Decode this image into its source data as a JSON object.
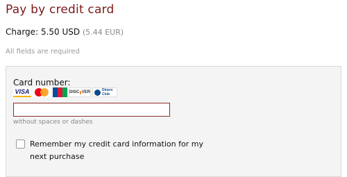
{
  "page_title": "Pay by credit card",
  "charge": {
    "label": "Charge:",
    "amount": "5.50 USD",
    "converted": "(5.44 EUR)"
  },
  "required_note": "All fields are required",
  "card_number": {
    "label": "Card number:",
    "value": "",
    "hint": "without spaces or dashes"
  },
  "card_logos": [
    {
      "icon": "visa-logo",
      "text": "VISA"
    },
    {
      "icon": "mastercard-logo",
      "text": "MasterCard"
    },
    {
      "icon": "jcb-logo",
      "text": "JCB"
    },
    {
      "icon": "discover-logo",
      "text": "DISCOVER"
    },
    {
      "icon": "diners-club-logo",
      "text": "Diners Club International"
    }
  ],
  "remember": {
    "checked": false,
    "label": "Remember my credit card information for my next purchase"
  },
  "colors": {
    "title": "#7a1a1a",
    "input_border": "#8b2a2a",
    "panel_bg": "#f4f4f4"
  }
}
